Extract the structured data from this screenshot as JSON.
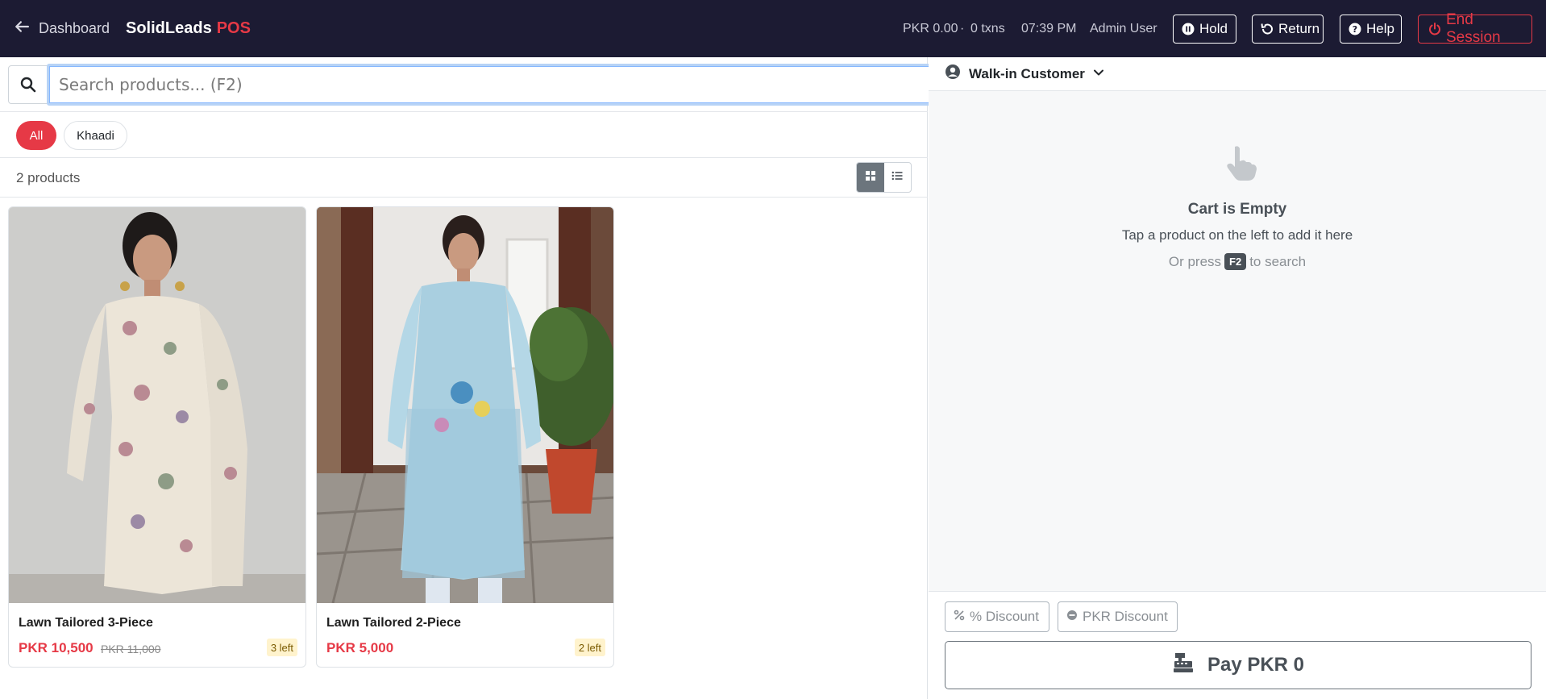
{
  "header": {
    "back_label": "Dashboard",
    "brand_name": "SolidLeads",
    "brand_suffix": "POS",
    "session_total": "PKR 0.00",
    "dot": "·",
    "txn_count": "0 txns",
    "time": "07:39 PM",
    "user": "Admin User",
    "hold_label": "Hold",
    "return_label": "Return",
    "help_label": "Help",
    "end_session_label": "End Session"
  },
  "search": {
    "placeholder": "Search products... (F2)",
    "value": ""
  },
  "categories": [
    {
      "label": "All",
      "active": true
    },
    {
      "label": "Khaadi",
      "active": false
    }
  ],
  "product_count": "2 products",
  "view_mode": "grid",
  "products": [
    {
      "name": "Lawn Tailored 3-Piece",
      "price": "PKR 10,500",
      "old_price": "PKR 11,000",
      "stock": "3 left"
    },
    {
      "name": "Lawn Tailored 2-Piece",
      "price": "PKR 5,000",
      "old_price": "",
      "stock": "2 left"
    }
  ],
  "cart": {
    "customer": "Walk-in Customer",
    "empty_title": "Cart is Empty",
    "empty_sub": "Tap a product on the left to add it here",
    "hint_prefix": "Or press",
    "hint_key": "F2",
    "hint_suffix": "to search",
    "percent_discount_label": "% Discount",
    "pkr_discount_label": "PKR Discount",
    "pay_label": "Pay PKR 0"
  },
  "colors": {
    "header_bg": "#1c1b33",
    "accent": "#e63946",
    "stock_badge_bg": "#fff3cd"
  }
}
